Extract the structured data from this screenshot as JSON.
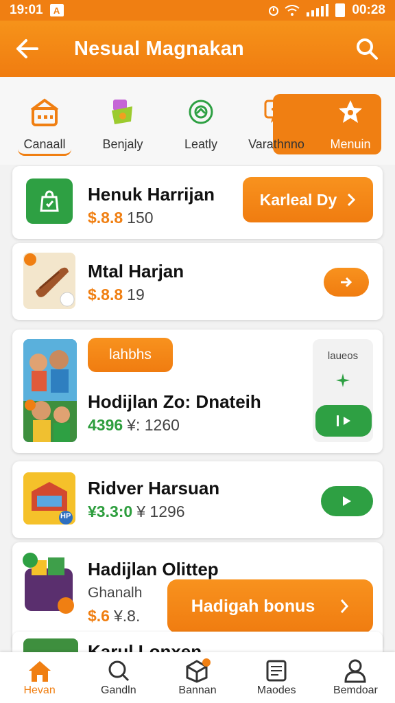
{
  "status": {
    "time": "19:01",
    "clock": "00:28",
    "badge": "A"
  },
  "appbar": {
    "title": "Nesual Magnakan"
  },
  "tabs": [
    {
      "label": "Canaall"
    },
    {
      "label": "Benjaly"
    },
    {
      "label": "Leatly"
    },
    {
      "label": "Varathnno"
    },
    {
      "label": "Menuin"
    }
  ],
  "cards": [
    {
      "title": "Henuk Harrijan",
      "price": "$.8.8",
      "sub": "150",
      "button": "Karleal Dy"
    },
    {
      "title": "Mtal Harjan",
      "price": "$.8.8",
      "sub": "19"
    },
    {
      "title": "Hodijlan Zo: Dnateih",
      "price": "4396",
      "sub": "¥: 1260",
      "badge": "lahbhs",
      "side_label": "laueos"
    },
    {
      "title": "Ridver Harsuan",
      "price": "¥3.3:0",
      "sub": "¥ 1296",
      "tag": "HP"
    },
    {
      "title": "Hadijlan Olittep",
      "subtitle": "Ghanalh",
      "price": "$.6",
      "sub": "¥.8.",
      "button": "Hadigah bonus"
    },
    {
      "title": "Karul Lonxen"
    }
  ],
  "nav": [
    {
      "label": "Hevan"
    },
    {
      "label": "Gandln"
    },
    {
      "label": "Bannan"
    },
    {
      "label": "Maodes"
    },
    {
      "label": "Bemdoar"
    }
  ],
  "colors": {
    "accent": "#f07f12",
    "green": "#2ea043"
  }
}
